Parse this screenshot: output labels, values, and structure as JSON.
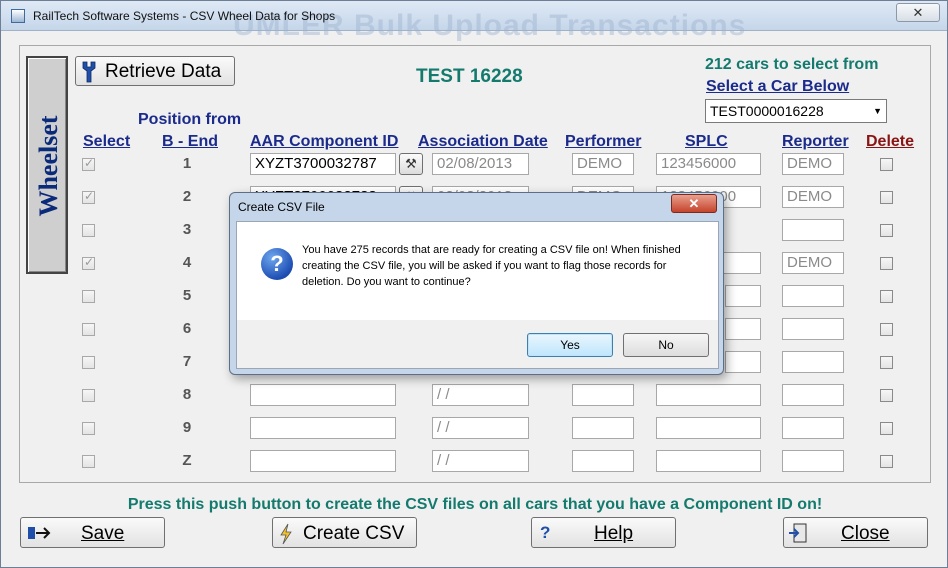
{
  "window": {
    "title": "RailTech Software Systems - CSV Wheel Data for Shops",
    "background_title": "UMLER Bulk Upload Transactions",
    "close_glyph": "✕"
  },
  "sidebar": {
    "tab_label": "Wheelset"
  },
  "toolbar": {
    "retrieve_label": "Retrieve Data"
  },
  "car": {
    "current": "TEST 16228",
    "count_text": "212 cars to select from",
    "select_label": "Select a Car Below",
    "selected_value": "TEST0000016228"
  },
  "columns": {
    "select": "Select",
    "position_top": "Position from",
    "position_bottom": "B - End",
    "component_id": "AAR Component ID",
    "association_date": "Association Date",
    "performer": "Performer",
    "splc": "SPLC",
    "reporter": "Reporter",
    "delete": "Delete"
  },
  "rows": [
    {
      "position": "1",
      "selected": true,
      "component_id": "XYZT3700032787",
      "date": "02/08/2013",
      "performer": "DEMO",
      "splc": "123456000",
      "reporter": "DEMO",
      "delete": false
    },
    {
      "position": "2",
      "selected": true,
      "component_id": "XYZT3700032788",
      "date": "02/08/2013",
      "performer": "DEMO",
      "splc": "123456000",
      "reporter": "DEMO",
      "delete": false
    },
    {
      "position": "3",
      "selected": false,
      "component_id": "",
      "date": "",
      "performer": "",
      "splc": "",
      "reporter": "",
      "delete": false
    },
    {
      "position": "4",
      "selected": true,
      "component_id": "",
      "date": "",
      "performer": "",
      "splc": "00",
      "reporter": "DEMO",
      "delete": false
    },
    {
      "position": "5",
      "selected": false,
      "component_id": "",
      "date": "",
      "performer": "",
      "splc": "",
      "reporter": "",
      "delete": false
    },
    {
      "position": "6",
      "selected": false,
      "component_id": "",
      "date": "",
      "performer": "",
      "splc": "",
      "reporter": "",
      "delete": false
    },
    {
      "position": "7",
      "selected": false,
      "component_id": "",
      "date": "",
      "performer": "",
      "splc": "",
      "reporter": "",
      "delete": false
    },
    {
      "position": "8",
      "selected": false,
      "component_id": "",
      "date": " / /",
      "performer": "",
      "splc": "",
      "reporter": "",
      "delete": false
    },
    {
      "position": "9",
      "selected": false,
      "component_id": "",
      "date": " / /",
      "performer": "",
      "splc": "",
      "reporter": "",
      "delete": false
    },
    {
      "position": "Z",
      "selected": false,
      "component_id": "",
      "date": " / /",
      "performer": "",
      "splc": "",
      "reporter": "",
      "delete": false
    }
  ],
  "footer": {
    "note": "Press this push button to create the CSV files on all cars that you have a Component ID on!",
    "save_label": "Save",
    "create_csv_label": "Create CSV",
    "help_label": "Help",
    "close_label": "Close"
  },
  "dialog": {
    "title": "Create CSV File",
    "close_glyph": "✕",
    "message": "You have 275 records that are ready for creating a CSV file on!  When finished creating the CSV file, you will be asked if you want to flag those records for deletion.  Do you want to continue?",
    "yes_label": "Yes",
    "no_label": "No"
  },
  "colors": {
    "header_blue": "#1b2b8c",
    "teal": "#147a6e",
    "delete_red": "#8a1414",
    "dialog_frame": "#c6d6ea"
  },
  "icons": {
    "retrieve": "wrench-icon",
    "component_lookup": "wrench-icon",
    "save": "save-arrow-icon",
    "create_csv": "lightning-icon",
    "help": "question-icon",
    "close": "exit-door-icon",
    "dialog": "question-mark-icon"
  }
}
